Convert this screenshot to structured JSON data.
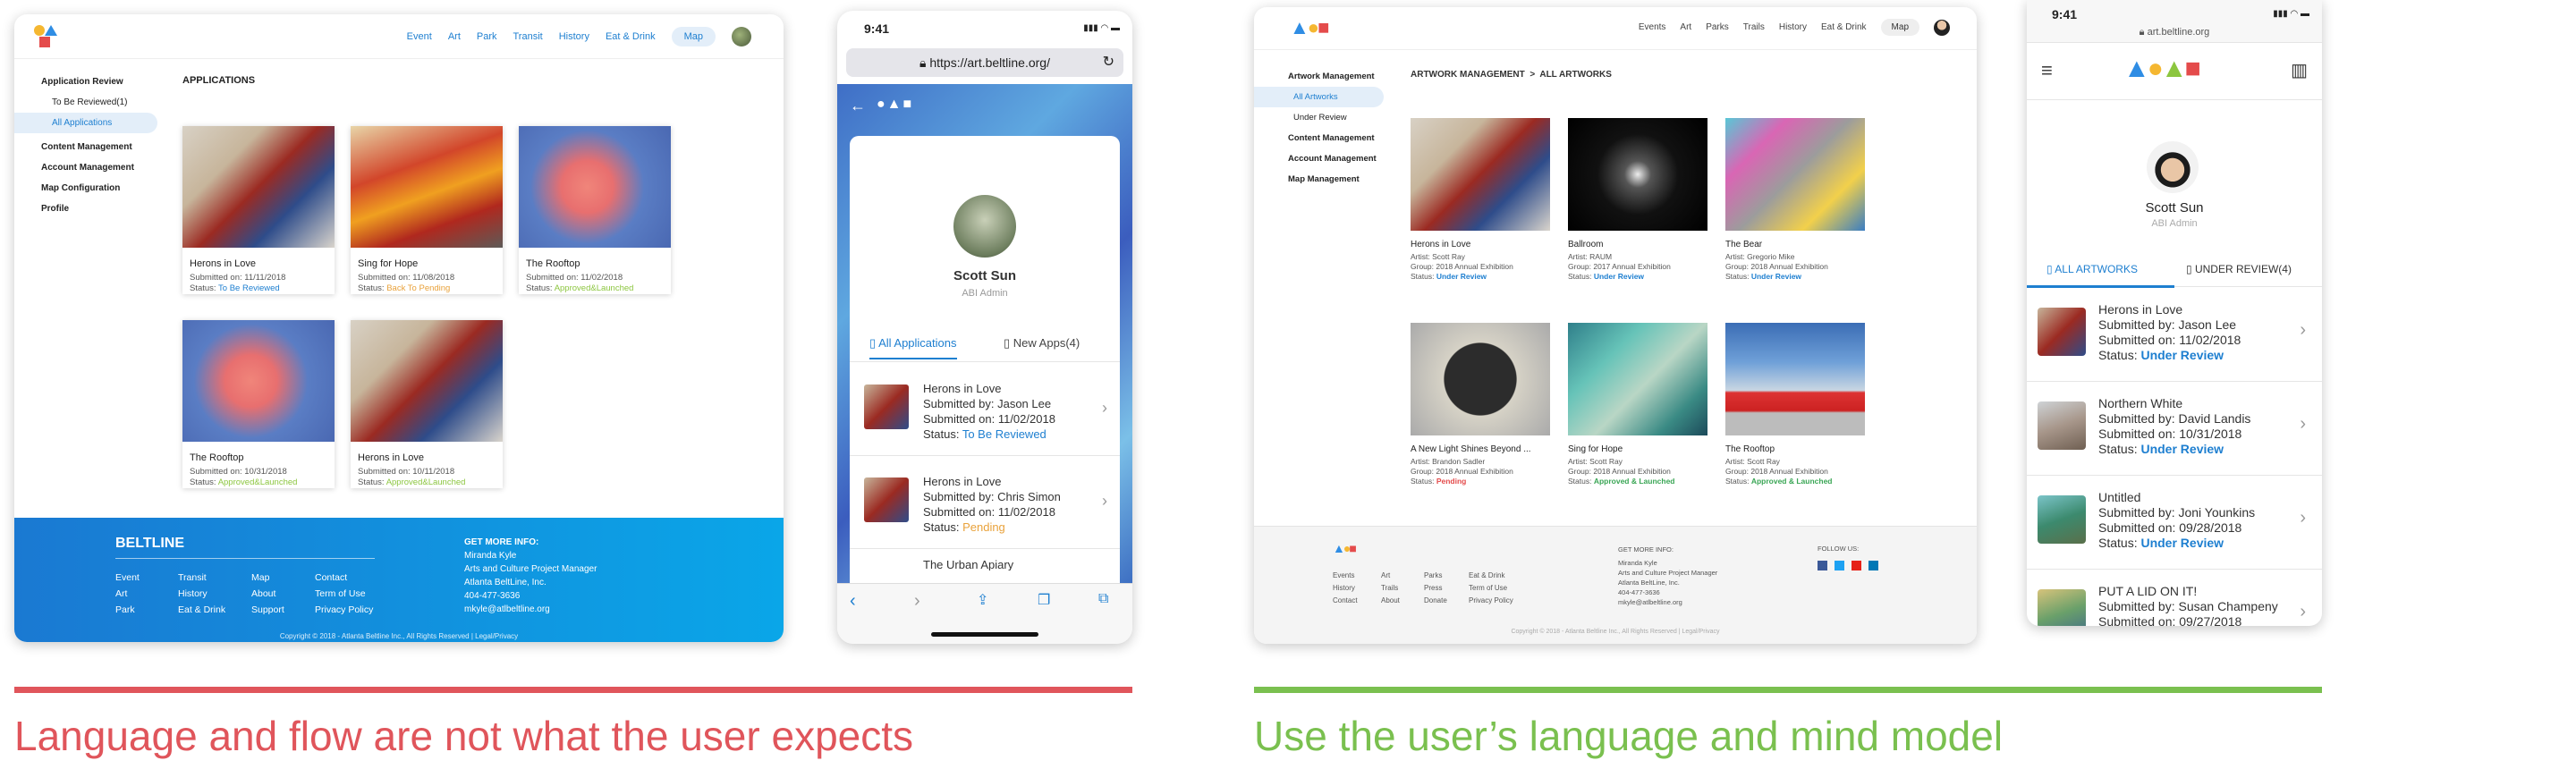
{
  "left_desktop": {
    "nav": [
      "Event",
      "Art",
      "Park",
      "Transit",
      "History",
      "Eat & Drink"
    ],
    "map_label": "Map",
    "sidebar": [
      {
        "label": "Application Review",
        "kind": "head"
      },
      {
        "label": "To Be Reviewed(1)",
        "kind": "sub"
      },
      {
        "label": "All Applications",
        "kind": "active"
      },
      {
        "label": "Content Management",
        "kind": "head"
      },
      {
        "label": "Account Management",
        "kind": "head"
      },
      {
        "label": "Map Configuration",
        "kind": "head"
      },
      {
        "label": "Profile",
        "kind": "head"
      }
    ],
    "section_title": "APPLICATIONS",
    "tiles": [
      {
        "title": "Herons in Love",
        "submitted": "Submitted on: 11/11/2018",
        "status_prefix": "Status: ",
        "status": "To Be Reviewed",
        "status_class": "rev"
      },
      {
        "title": "Sing for Hope",
        "submitted": "Submitted on: 11/08/2018",
        "status_prefix": "Status: ",
        "status": "Back To Pending",
        "status_class": "bad"
      },
      {
        "title": "The Rooftop",
        "submitted": "Submitted on: 11/02/2018",
        "status_prefix": "Status: ",
        "status": "Approved&Launched",
        "status_class": "ok"
      },
      {
        "title": "The Rooftop",
        "submitted": "Submitted on: 10/31/2018",
        "status_prefix": "Status: ",
        "status": "Approved&Launched",
        "status_class": "ok"
      },
      {
        "title": "Herons in Love",
        "submitted": "Submitted on: 10/11/2018",
        "status_prefix": "Status: ",
        "status": "Approved&Launched",
        "status_class": "ok"
      }
    ],
    "footer": {
      "brand": "BELTLINE",
      "cols": [
        [
          "Event",
          "Art",
          "Park"
        ],
        [
          "Transit",
          "History",
          "Eat & Drink"
        ],
        [
          "Map",
          "About",
          "Support"
        ],
        [
          "Contact",
          "Term of Use",
          "Privacy Policy"
        ]
      ],
      "info_title": "GET MORE INFO:",
      "info": [
        "Miranda Kyle",
        "Arts and Culture Project Manager",
        "Atlanta BeltLine, Inc.",
        "404-477-3636",
        "mkyle@atlbeltline.org"
      ],
      "copyright": "Copyright © 2018 - Atlanta Beltline Inc., All Rights Reserved | Legal/Privacy"
    }
  },
  "left_phone": {
    "time": "9:41",
    "url": "https://art.beltline.org/",
    "user_name": "Scott Sun",
    "user_role": "ABI Admin",
    "tab_all": "All Applications",
    "tab_new": "New Apps(4)",
    "rows": [
      {
        "title": "Herons in Love",
        "by": "Submitted by: Jason Lee",
        "on": "Submitted on: 11/02/2018",
        "status_prefix": "Status: ",
        "status": "To Be Reviewed",
        "status_class": "rev"
      },
      {
        "title": "Herons in Love",
        "by": "Submitted by: Chris Simon",
        "on": "Submitted on: 11/02/2018",
        "status_prefix": "Status: ",
        "status": "Pending",
        "status_class": "bad"
      },
      {
        "title": "The Urban Apiary",
        "by": "",
        "on": "",
        "status_prefix": "",
        "status": "",
        "status_class": ""
      }
    ]
  },
  "right_desktop": {
    "nav": [
      "Events",
      "Art",
      "Parks",
      "Trails",
      "History",
      "Eat & Drink"
    ],
    "map_label": "Map",
    "sidebar": [
      {
        "label": "Artwork Management",
        "kind": "head"
      },
      {
        "label": "All Artworks",
        "kind": "active"
      },
      {
        "label": "Under Review",
        "kind": "sub"
      },
      {
        "label": "Content Management",
        "kind": "head"
      },
      {
        "label": "Account Management",
        "kind": "head"
      },
      {
        "label": "Map Management",
        "kind": "head"
      }
    ],
    "breadcrumb": "ARTWORK MANAGEMENT  >  ALL ARTWORKS",
    "items": [
      {
        "title": "Herons in Love",
        "artist": "Artist: Scott Ray",
        "group": "Group: 2018 Annual Exhibition",
        "status_prefix": "Status: ",
        "status": "Under Review",
        "status_class": "rev"
      },
      {
        "title": "Ballroom",
        "artist": "Artist: RAUM",
        "group": "Group: 2017 Annual Exhibition",
        "status_prefix": "Status: ",
        "status": "Under Review",
        "status_class": "rev"
      },
      {
        "title": "The Bear",
        "artist": "Artist: Gregorio Mike",
        "group": "Group: 2018 Annual Exhibition",
        "status_prefix": "Status: ",
        "status": "Under Review",
        "status_class": "rev"
      },
      {
        "title": "A New Light Shines Beyond ...",
        "artist": "Artist: Brandon Sadler",
        "group": "Group: 2018 Annual Exhibition",
        "status_prefix": "Status: ",
        "status": "Pending",
        "status_class": "pend"
      },
      {
        "title": "Sing for Hope",
        "artist": "Artist: Scott Ray",
        "group": "Group: 2018 Annual Exhibition",
        "status_prefix": "Status: ",
        "status": "Approved & Launched",
        "status_class": "ok2"
      },
      {
        "title": "The Rooftop",
        "artist": "Artist: Scott Ray",
        "group": "Group: 2018 Annual Exhibition",
        "status_prefix": "Status: ",
        "status": "Approved & Launched",
        "status_class": "ok2"
      }
    ],
    "footer": {
      "cols": [
        [
          "Events",
          "History",
          "Contact"
        ],
        [
          "Art",
          "Trails",
          "About"
        ],
        [
          "Parks",
          "Press",
          "Donate"
        ],
        [
          "Eat & Drink",
          "Term of Use",
          "Privacy Policy"
        ]
      ],
      "info_title": "GET MORE INFO:",
      "info": [
        "Miranda Kyle",
        "Arts and Culture Project Manager",
        "Atlanta BeltLine, Inc.",
        "404-477-3636",
        "mkyle@atlbeltline.org"
      ],
      "follow": "FOLLOW US:",
      "copyright": "Copyright © 2018 - Atlanta Beltline Inc., All Rights Reserved | Legal/Privacy"
    }
  },
  "right_phone": {
    "time": "9:41",
    "url": "art.beltline.org",
    "user_name": "Scott Sun",
    "user_role": "ABI Admin",
    "tab_all": "ALL ARTWORKS",
    "tab_review": "UNDER REVIEW(4)",
    "rows": [
      {
        "title": "Herons in Love",
        "by": "Submitted by: Jason Lee",
        "on": "Submitted on: 11/02/2018",
        "status_prefix": "Status: ",
        "status": "Under Review"
      },
      {
        "title": "Northern White",
        "by": "Submitted by: David Landis",
        "on": "Submitted on: 10/31/2018",
        "status_prefix": "Status: ",
        "status": "Under Review"
      },
      {
        "title": "Untitled",
        "by": "Submitted by: Joni Younkins",
        "on": "Submitted on: 09/28/2018",
        "status_prefix": "Status: ",
        "status": "Under Review"
      },
      {
        "title": "PUT A LID ON IT!",
        "by": "Submitted by: Susan Champeny",
        "on": "Submitted on: 09/27/2018",
        "status_prefix": "",
        "status": ""
      }
    ]
  },
  "captions": {
    "bad": "Language and flow are not what the user expects",
    "good": "Use the user’s language and mind model"
  },
  "colors": {
    "red": "#e0555b",
    "green": "#7ac04f",
    "blue": "#1e7fd0"
  }
}
